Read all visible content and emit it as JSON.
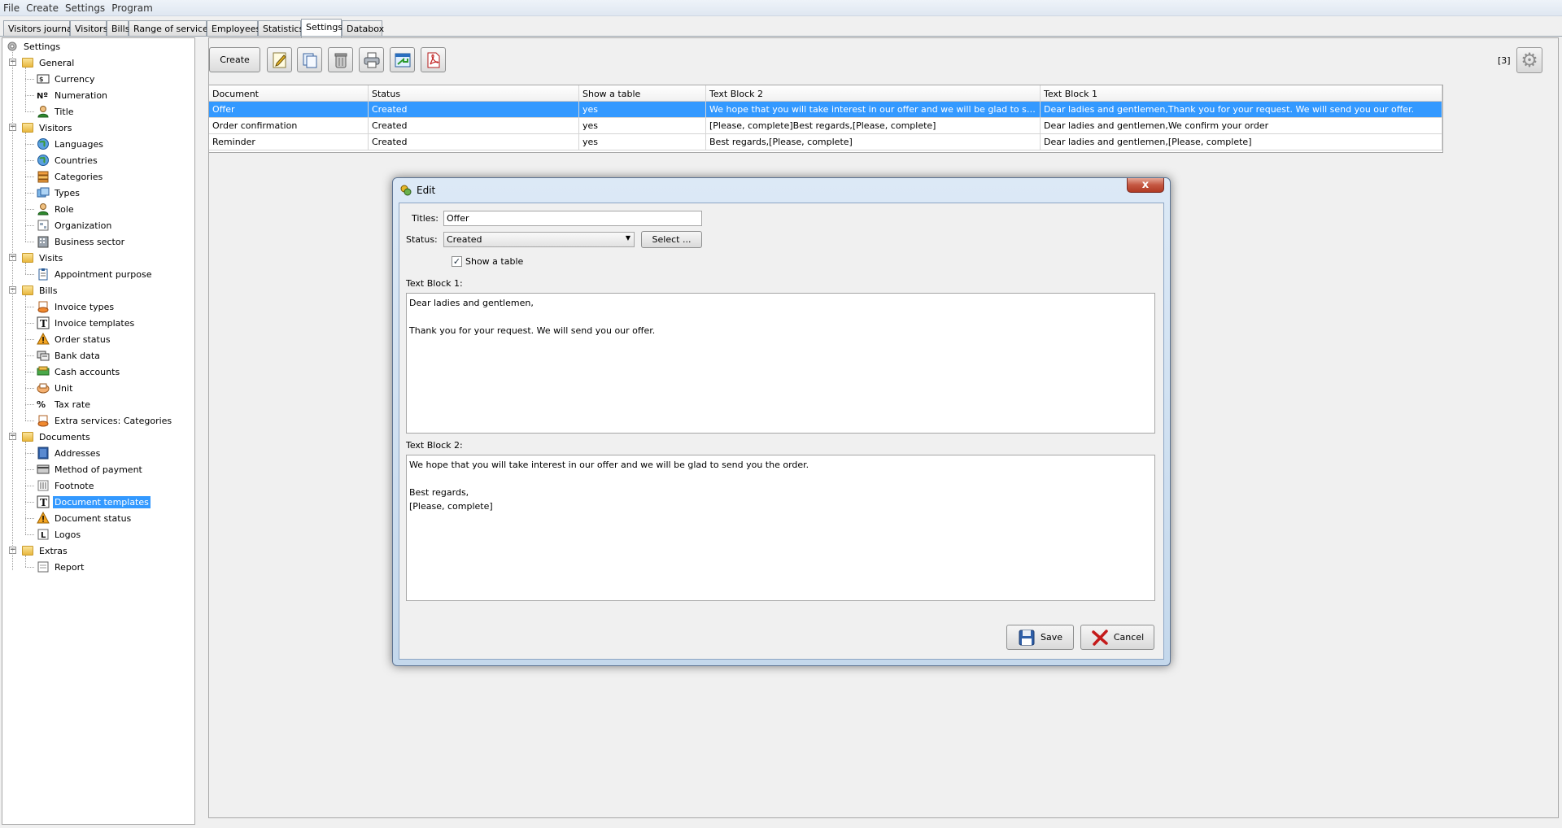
{
  "menu": [
    "File",
    "Create",
    "Settings",
    "Program"
  ],
  "tabs": [
    "Visitors journal",
    "Visitors",
    "Bills",
    "Range of services",
    "Employees",
    "Statistics",
    "Settings",
    "Databox"
  ],
  "active_tab": "Settings",
  "tree": {
    "root": "Settings",
    "groups": [
      {
        "label": "General",
        "items": [
          {
            "label": "Currency",
            "icon": "currency-icon"
          },
          {
            "label": "Numeration",
            "icon": "numero-sign-icon"
          },
          {
            "label": "Title",
            "icon": "person-icon"
          }
        ]
      },
      {
        "label": "Visitors",
        "items": [
          {
            "label": "Languages",
            "icon": "globe-icon"
          },
          {
            "label": "Countries",
            "icon": "globe-icon"
          },
          {
            "label": "Categories",
            "icon": "categories-icon"
          },
          {
            "label": "Types",
            "icon": "types-icon"
          },
          {
            "label": "Role",
            "icon": "person-icon"
          },
          {
            "label": "Organization",
            "icon": "organization-icon"
          },
          {
            "label": "Business sector",
            "icon": "building-icon"
          }
        ]
      },
      {
        "label": "Visits",
        "items": [
          {
            "label": "Appointment purpose",
            "icon": "clipboard-icon"
          }
        ]
      },
      {
        "label": "Bills",
        "items": [
          {
            "label": "Invoice types",
            "icon": "invoice-icon"
          },
          {
            "label": "Invoice templates",
            "icon": "text-template-icon"
          },
          {
            "label": "Order status",
            "icon": "warning-icon"
          },
          {
            "label": "Bank data",
            "icon": "bank-icon"
          },
          {
            "label": "Cash accounts",
            "icon": "cash-icon"
          },
          {
            "label": "Unit",
            "icon": "unit-icon"
          },
          {
            "label": "Tax rate",
            "icon": "percent-icon"
          },
          {
            "label": "Extra services: Categories",
            "icon": "services-icon"
          }
        ]
      },
      {
        "label": "Documents",
        "items": [
          {
            "label": "Addresses",
            "icon": "address-book-icon"
          },
          {
            "label": "Method of payment",
            "icon": "payment-icon"
          },
          {
            "label": "Footnote",
            "icon": "footnote-icon"
          },
          {
            "label": "Document templates",
            "icon": "text-template-icon",
            "selected": true
          },
          {
            "label": "Document status",
            "icon": "warning-icon"
          },
          {
            "label": "Logos",
            "icon": "logo-icon"
          }
        ]
      },
      {
        "label": "Extras",
        "items": [
          {
            "label": "Report",
            "icon": "report-icon"
          }
        ]
      }
    ]
  },
  "toolbar": {
    "create_label": "Create"
  },
  "counter": "[3]",
  "table": {
    "columns": [
      "Document",
      "Status",
      "Show a table",
      "Text Block 2",
      "Text Block 1"
    ],
    "rows": [
      [
        "Offer",
        "Created",
        "yes",
        "We hope that you will take interest in our offer and we will be glad to send you the order.Best regards,[Please, complete]",
        "Dear ladies and gentlemen,Thank you for your request. We will send you our offer."
      ],
      [
        "Order confirmation",
        "Created",
        "yes",
        "[Please, complete]Best regards,[Please, complete]",
        "Dear ladies and gentlemen,We confirm your order"
      ],
      [
        "Reminder",
        "Created",
        "yes",
        "Best regards,[Please, complete]",
        "Dear ladies and gentlemen,[Please, complete]"
      ]
    ],
    "selected_row": 0
  },
  "dialog": {
    "title": "Edit",
    "close_label": "x",
    "titles_label": "Titles:",
    "titles_value": "Offer",
    "status_label": "Status:",
    "status_value": "Created",
    "select_label": "Select ...",
    "show_table_label": "Show a table",
    "show_table_checked": true,
    "text_block_1_label": "Text Block 1:",
    "text_block_1": "Dear ladies and gentlemen,\n\nThank you for your request. We will send you our offer.",
    "text_block_2_label": "Text Block 2:",
    "text_block_2": "We hope that you will take interest in our offer and we will be glad to send you the order.\n\nBest regards,\n[Please, complete]",
    "save_label": "Save",
    "cancel_label": "Cancel"
  },
  "colors": {
    "selection": "#3399ff",
    "background": "#f0f0f0"
  }
}
